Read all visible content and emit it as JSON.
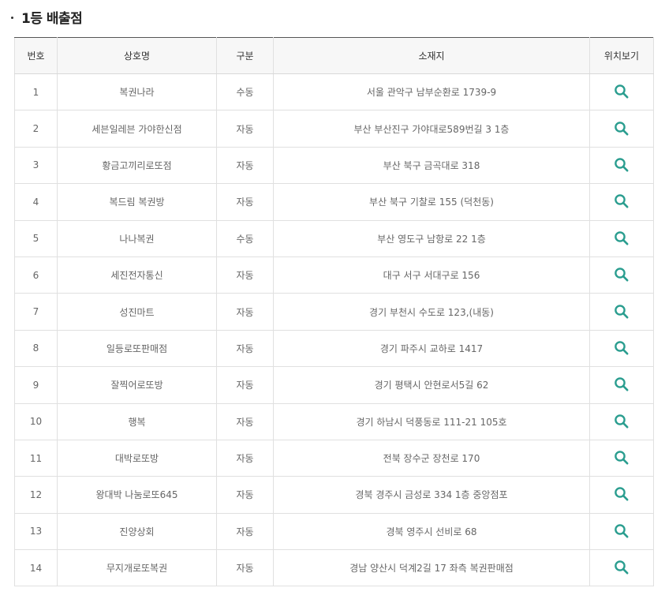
{
  "section": {
    "title": "1등 배출점"
  },
  "table": {
    "headers": [
      "번호",
      "상호명",
      "구분",
      "소재지",
      "위치보기"
    ],
    "rows": [
      {
        "no": "1",
        "name": "복권나라",
        "type": "수동",
        "address": "서울 관악구 남부순환로 1739-9"
      },
      {
        "no": "2",
        "name": "세븐일레븐 가야한신점",
        "type": "자동",
        "address": "부산 부산진구 가야대로589번길 3 1층"
      },
      {
        "no": "3",
        "name": "황금고끼리로또점",
        "type": "자동",
        "address": "부산 북구 금곡대로 318"
      },
      {
        "no": "4",
        "name": "복드림 복권방",
        "type": "자동",
        "address": "부산 북구 기찰로 155 (덕천동)"
      },
      {
        "no": "5",
        "name": "나나복권",
        "type": "수동",
        "address": "부산 영도구 남항로 22 1층"
      },
      {
        "no": "6",
        "name": "세진전자통신",
        "type": "자동",
        "address": "대구 서구 서대구로 156"
      },
      {
        "no": "7",
        "name": "성진마트",
        "type": "자동",
        "address": "경기 부천시 수도로 123,(내동)"
      },
      {
        "no": "8",
        "name": "일등로또판매점",
        "type": "자동",
        "address": "경기 파주시 교하로 1417"
      },
      {
        "no": "9",
        "name": "잘찍어로또방",
        "type": "자동",
        "address": "경기 평택시 안현로서5길 62"
      },
      {
        "no": "10",
        "name": "행복",
        "type": "자동",
        "address": "경기 하남시 덕풍동로 111-21 105호"
      },
      {
        "no": "11",
        "name": "대박로또방",
        "type": "자동",
        "address": "전북 장수군 장천로 170"
      },
      {
        "no": "12",
        "name": "왕대박 나눔로또645",
        "type": "자동",
        "address": "경북 경주시 금성로 334 1층 중앙점포"
      },
      {
        "no": "13",
        "name": "진양상회",
        "type": "자동",
        "address": "경북 영주시 선비로 68"
      },
      {
        "no": "14",
        "name": "무지개로또복권",
        "type": "자동",
        "address": "경남 양산시 덕계2길 17 좌측 복권판매점"
      }
    ]
  },
  "icons": {
    "location": "search-icon",
    "accent": "#2a9d8f"
  }
}
